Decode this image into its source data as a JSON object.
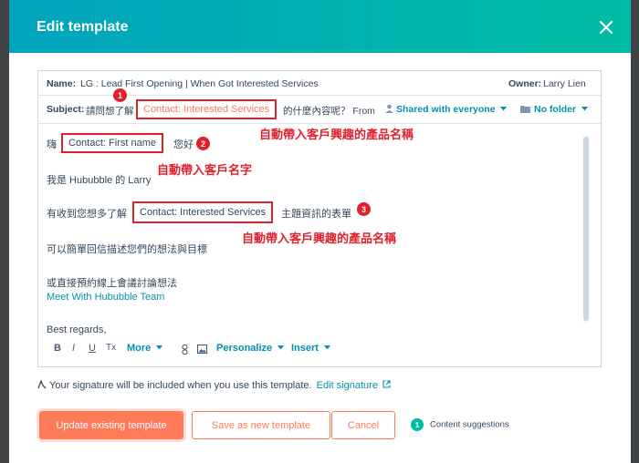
{
  "modal": {
    "title": "Edit template"
  },
  "header_row": {
    "name_label": "Name:",
    "name_value": "LG : Lead First Opening | When Got Interested Services",
    "owner_label": "Owner:",
    "owner_value": "Larry Lien"
  },
  "subject_row": {
    "label": "Subject:",
    "prefix": "請問想了解",
    "token": "Contact: Interested Services",
    "suffix": "的什麼內容呢？ From",
    "shared": "Shared with everyone",
    "folder": "No folder"
  },
  "body": {
    "greeting": "嗨",
    "name_token": "Contact: First name",
    "hello": "您好",
    "line_intro": "我是 Hububble 的 Larry",
    "want_prefix": "有收到您想多了解",
    "services_token": "Contact: Interested Services",
    "want_suffix": "主題資訊的表單",
    "reply": "可以簡單回信描述您們的想法與目標",
    "booking": "或直接預約線上會議討論想法",
    "meeting_link": "Meet With Hububble Team",
    "closing": "Best regards,"
  },
  "annotations": [
    {
      "badge": "1",
      "note": "自動帶入客戶興趣的產品名稱"
    },
    {
      "badge": "2",
      "note": "自動帶入客戶名字"
    },
    {
      "badge": "3",
      "note": "自動帶入客戶興趣的產品名稱"
    }
  ],
  "toolbar": {
    "bold": "B",
    "italic": "I",
    "underline": "U",
    "clear_format": "Tx",
    "more": "More",
    "personalize": "Personalize",
    "insert": "Insert"
  },
  "signature": {
    "text": "Your signature will be included when you use this template.",
    "edit_link": "Edit signature"
  },
  "buttons": {
    "update": "Update existing template",
    "save_new": "Save as new template",
    "cancel": "Cancel"
  },
  "content_suggestions": {
    "count": "1",
    "label": "Content suggestions"
  },
  "colors": {
    "header_start": "#00a4bd",
    "header_end": "#00bda5",
    "accent_orange": "#ff7a59",
    "link_teal": "#0091ae",
    "annotation_red": "#e0202b"
  }
}
